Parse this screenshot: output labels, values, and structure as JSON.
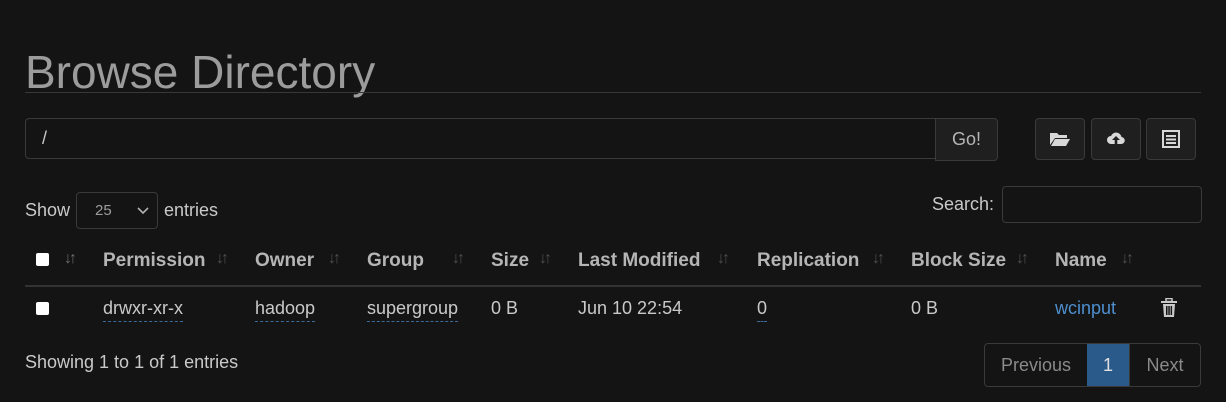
{
  "page": {
    "title": "Browse Directory"
  },
  "path": {
    "value": "/",
    "go_label": "Go!"
  },
  "toolbar": {
    "icons": [
      "folder-open-icon",
      "upload-cloud-icon",
      "list-icon"
    ]
  },
  "length": {
    "show_label": "Show",
    "selected": "25",
    "entries_label": "entries"
  },
  "search": {
    "label": "Search:",
    "value": ""
  },
  "table": {
    "columns": [
      "Permission",
      "Owner",
      "Group",
      "Size",
      "Last Modified",
      "Replication",
      "Block Size",
      "Name"
    ],
    "rows": [
      {
        "permission": "drwxr-xr-x",
        "owner": "hadoop",
        "group": "supergroup",
        "size": "0 B",
        "last_modified": "Jun 10 22:54",
        "replication": "0",
        "block_size": "0 B",
        "name": "wcinput"
      }
    ]
  },
  "info": {
    "text": "Showing 1 to 1 of 1 entries"
  },
  "pagination": {
    "previous": "Previous",
    "page": "1",
    "next": "Next"
  },
  "colors": {
    "background": "#141414",
    "link": "#4d8fcf",
    "active_page": "#2a5a8a"
  }
}
